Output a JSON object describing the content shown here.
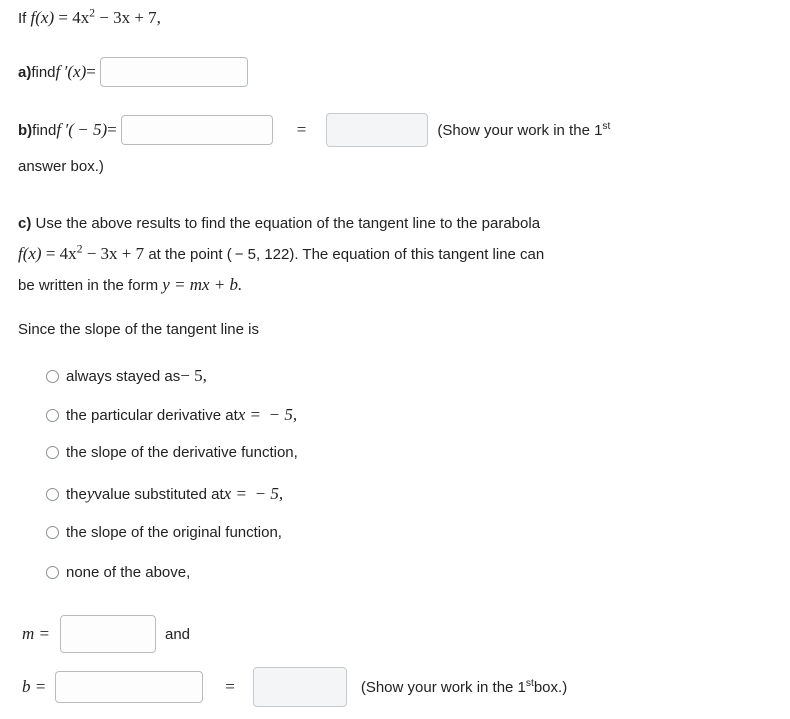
{
  "problem": {
    "intro_prefix": "If ",
    "intro_fn": "f(x)",
    "intro_eq": " = 4x",
    "intro_exp": "2",
    "intro_rest": " − 3x + 7,",
    "part_a": {
      "label": "a)",
      "text": " find ",
      "expr": "f ′(x)",
      "equals": " = ",
      "answer_value": "",
      "answer_placeholder": ""
    },
    "part_b": {
      "label": "b)",
      "text": " find ",
      "expr": "f ′( − 5)",
      "equals": " = ",
      "answer_value": "",
      "equals2": "=",
      "note": "(Show your work in the 1",
      "note_sup": "st",
      "note_cont": " answer box.)"
    },
    "part_c": {
      "label": "c)",
      "line1": " Use the above results to find the equation of the tangent line to the parabola",
      "fn": "f(x)",
      "eq1": " = 4x",
      "exp": "2",
      "eq2": " − 3x + 7",
      "line2_rest": " at the point ( − 5, 122). The equation of this tangent line can",
      "line3_prefix": "be written in the form ",
      "form": "y = mx + b.",
      "since": "Since the slope of the tangent line is"
    },
    "options": [
      {
        "text": "always stayed as ",
        "math": "− 5,",
        "kind": "plain"
      },
      {
        "text": "the particular derivative at ",
        "math": "x =  − 5,",
        "kind": "math"
      },
      {
        "text": "the slope of the derivative function,",
        "math": "",
        "kind": "plain"
      },
      {
        "text": "the ",
        "math": "y",
        "kind": "split",
        "tail": " value substituted at ",
        "tail_math": "x =  − 5,"
      },
      {
        "text": "the slope of the original function,",
        "math": "",
        "kind": "plain"
      },
      {
        "text": "none of the above,",
        "math": "",
        "kind": "plain"
      }
    ],
    "final": {
      "m_label": "m =",
      "m_value": "",
      "and_label": "and",
      "b_label": "b =",
      "b_value": "",
      "equals": "=",
      "note": "(Show your work in the 1",
      "note_sup": "st",
      "note_cont": " box.)"
    }
  }
}
